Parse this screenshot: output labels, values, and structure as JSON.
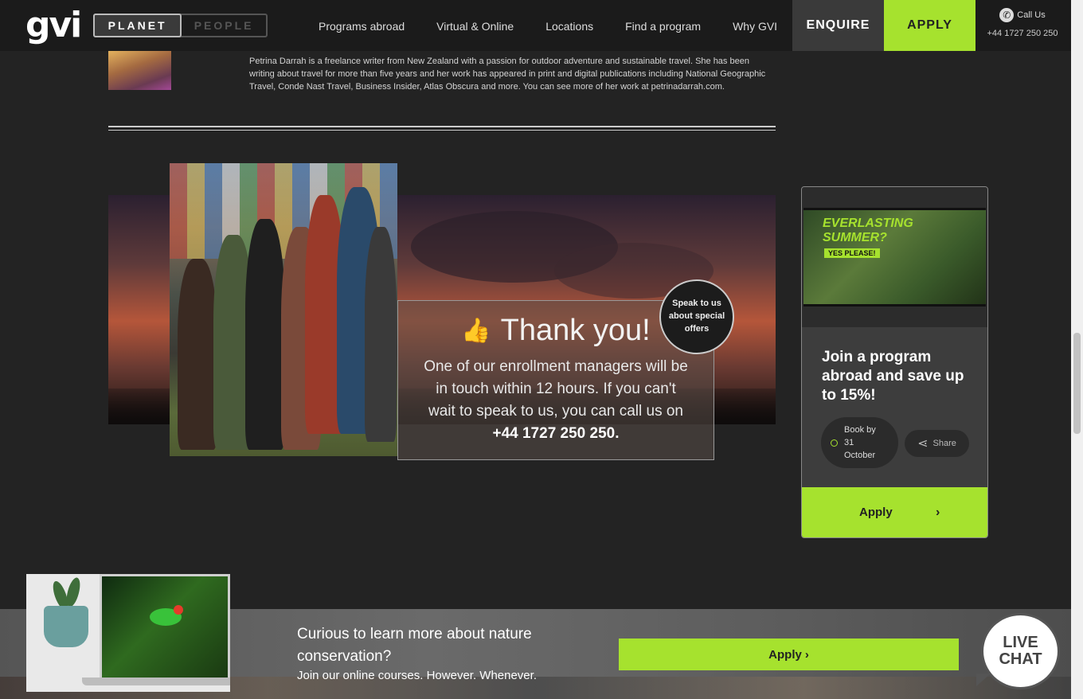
{
  "header": {
    "logo": "gvi",
    "toggle": {
      "active": "PLANET",
      "inactive": "PEOPLE"
    },
    "nav": [
      "Programs abroad",
      "Virtual & Online",
      "Locations",
      "Find a program",
      "Why GVI"
    ],
    "enquire_label": "ENQUIRE",
    "apply_label": "APPLY",
    "call_label": "Call Us",
    "phone": "+44 1727 250 250"
  },
  "author": {
    "bio": "Petrina Darrah is a freelance writer from New Zealand with a passion for outdoor adventure and sustainable travel. She has been writing about travel for more than five years and her work has appeared in print and digital publications including National Geographic Travel, Conde Nast Travel, Business Insider, Atlas Obscura and more. You can see more of her work at petrinadarrah.com."
  },
  "hero": {
    "thanks_title": "Thank you!",
    "thanks_text": "One of our enrollment managers will be in touch within 12 hours. If you can't wait to speak to us, you can call us on",
    "thanks_phone": "+44 1727 250 250.",
    "offers_badge": "Speak to us about special offers"
  },
  "sidebar_card": {
    "image_slogan_line1": "EVERLASTING",
    "image_slogan_line2": "SUMMER?",
    "image_slogan_line3": "YES PLEASE!",
    "title": "Join a program abroad and save up to 15%!",
    "book_by": "Book by 31 October",
    "share_label": "Share",
    "apply_label": "Apply",
    "accent_color": "#a6e22e"
  },
  "banner": {
    "title": "Curious to learn more about nature conservation?",
    "subtitle": "Join our online courses. However. Whenever.",
    "apply_label": "Apply"
  },
  "live_chat": {
    "line1": "LIVE",
    "line2": "CHAT"
  }
}
